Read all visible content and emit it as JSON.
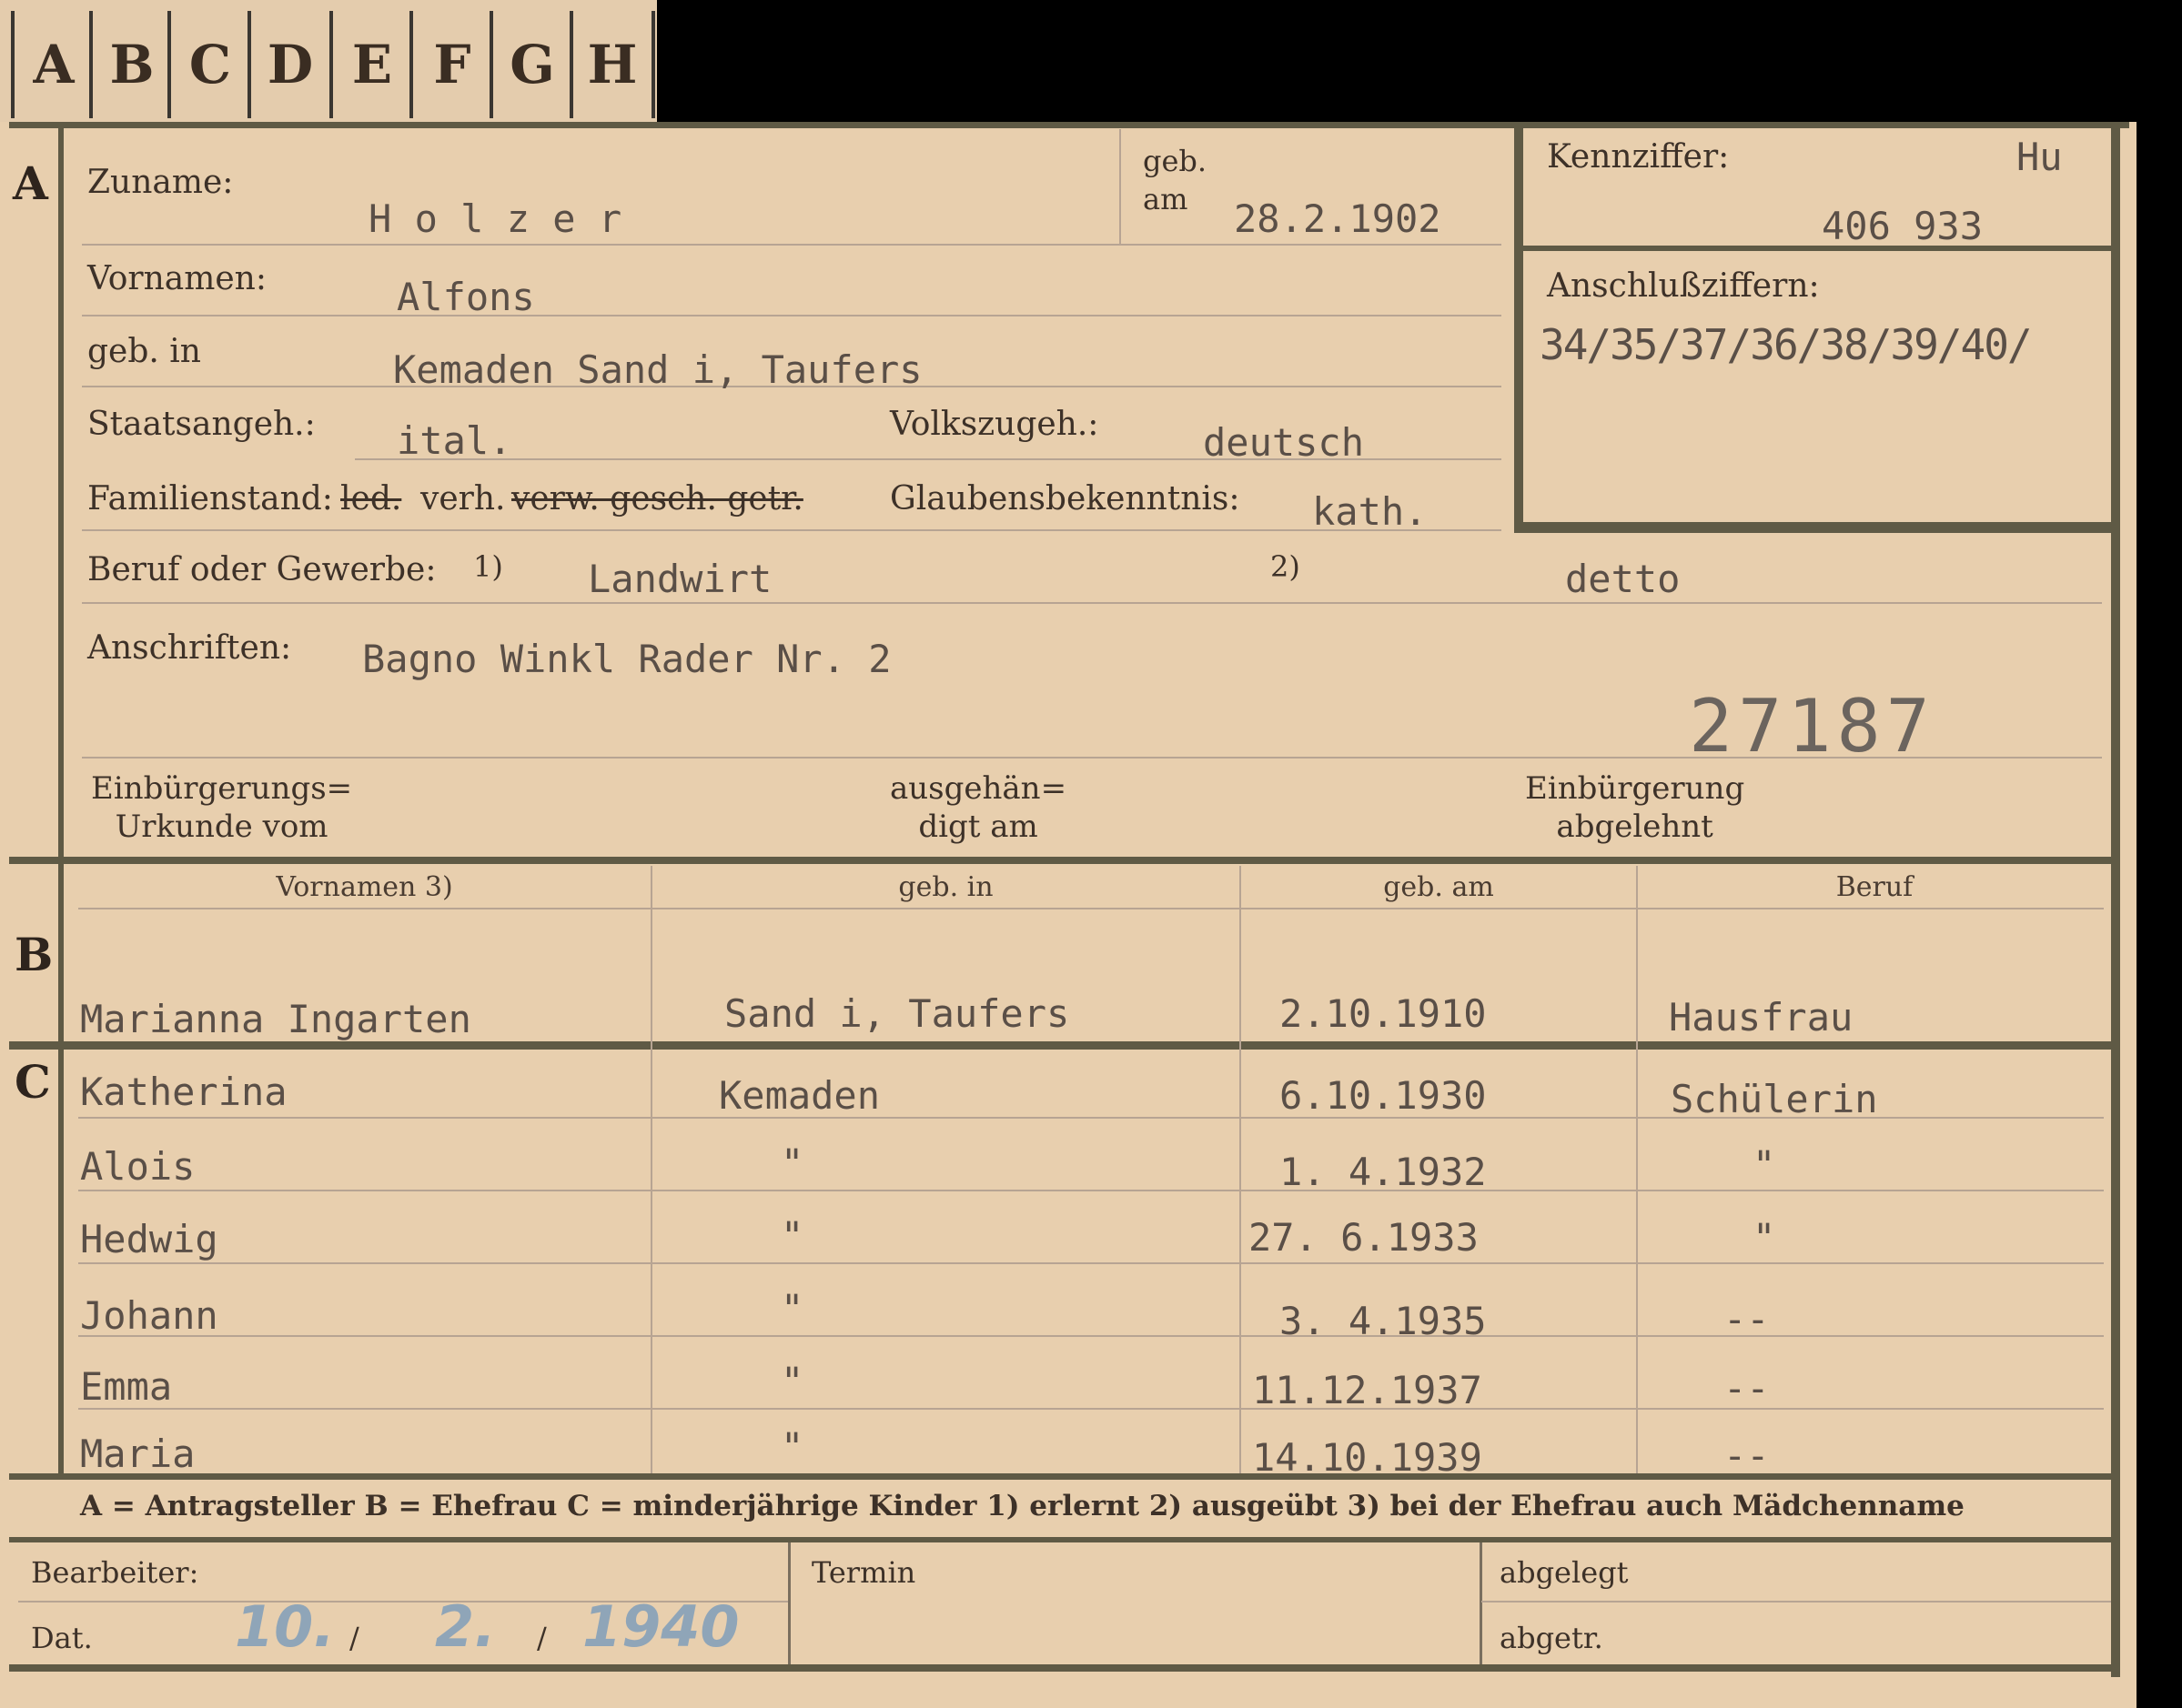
{
  "tabs": [
    "A",
    "B",
    "C",
    "D",
    "E",
    "F",
    "G",
    "H"
  ],
  "sections": {
    "a": "A",
    "b": "B",
    "c": "C"
  },
  "person": {
    "zuname_label": "Zuname:",
    "zuname": "H o l z e r",
    "geb_label": "geb.",
    "am_label": "am",
    "geb_am": "28.2.1902",
    "kennziffer_label": "Kennziffer:",
    "kennziffer_code": "Hu",
    "kennziffer": "406 933",
    "anschluss_label": "Anschlußziffern:",
    "anschluss": "34/35/37/36/38/39/40/",
    "vornamen_label": "Vornamen:",
    "vornamen": "Alfons",
    "geb_in_label": "geb. in",
    "geb_in": "Kemaden Sand i, Taufers",
    "staat_label": "Staatsangeh.:",
    "staat": "ital.",
    "volk_label": "Volkszugeh.:",
    "volk": "deutsch",
    "familie_label": "Familienstand:",
    "familie_struck1": "led.",
    "familie": "verh.",
    "familie_struck2": "verw. gesch. getr.",
    "glaube_label": "Glaubensbekenntnis:",
    "glaube": "kath.",
    "beruf_label": "Beruf oder Gewerbe:",
    "beruf_note1": "1)",
    "beruf": "Landwirt",
    "beruf_note2": "2)",
    "beruf2": "detto",
    "anschrift_label": "Anschriften:",
    "anschrift": "Bagno Winkl Rader Nr. 2",
    "stamp_number": "27187",
    "einb_label_1": "Einbürgerungs=",
    "einb_label_2": "Urkunde vom",
    "ausg_label_1": "ausgehän=",
    "ausg_label_2": "digt am",
    "abgel_label_1": "Einbürgerung",
    "abgel_label_2": "abgelehnt"
  },
  "family_table": {
    "headers": [
      "Vornamen 3)",
      "geb. in",
      "geb. am",
      "Beruf"
    ],
    "spouse": {
      "name": "Marianna Ingarten",
      "place": "Sand i, Taufers",
      "date": "2.10.1910",
      "job": "Hausfrau"
    },
    "children": [
      {
        "name": "Katherina",
        "place": "Kemaden",
        "date": "6.10.1930",
        "job": "Schülerin"
      },
      {
        "name": "Alois",
        "place": "\"",
        "date": "1. 4.1932",
        "job": "\""
      },
      {
        "name": "Hedwig",
        "place": "\"",
        "date": "27. 6.1933",
        "job": "\""
      },
      {
        "name": "Johann",
        "place": "\"",
        "date": "3. 4.1935",
        "job": "--"
      },
      {
        "name": "Emma",
        "place": "\"",
        "date": "11.12.1937",
        "job": "--"
      },
      {
        "name": "Maria",
        "place": "\"",
        "date": "14.10.1939",
        "job": "--"
      }
    ]
  },
  "legend": "A = Antragsteller   B = Ehefrau   C = minderjährige Kinder   1) erlernt   2) ausgeübt   3) bei der Ehefrau auch Mädchenname",
  "footer": {
    "bearbeiter_label": "Bearbeiter:",
    "dat_label": "Dat.",
    "dat_day": "10.",
    "dat_month": "2.",
    "dat_year": "1940",
    "slash": "/",
    "termin_label": "Termin",
    "abgelegt_label": "abgelegt",
    "abgetr_label": "abgetr."
  }
}
